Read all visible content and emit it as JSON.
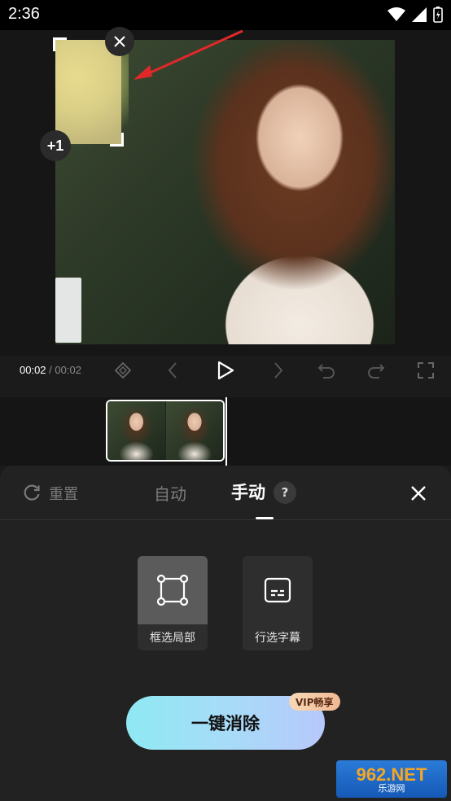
{
  "status": {
    "time": "2:36"
  },
  "preview": {
    "close_box_glyph": "×",
    "plus_one": "+1"
  },
  "player": {
    "current_time": "00:02",
    "separator": " / ",
    "total_time": "00:02",
    "controls": [
      "keyframe-icon",
      "prev-icon",
      "play-icon",
      "next-icon",
      "undo-icon",
      "redo-icon",
      "fullscreen-icon"
    ]
  },
  "panel": {
    "reset_label": "重置",
    "tab_auto": "自动",
    "tab_manual": "手动",
    "help_glyph": "?",
    "options": [
      {
        "label": "框选局部",
        "icon": "box-select-icon",
        "selected": true
      },
      {
        "label": "行选字幕",
        "icon": "subtitle-icon",
        "selected": false
      }
    ],
    "remove_button": "一键消除",
    "vip_badge": "VIP畅享"
  },
  "watermark": {
    "brand": "962.NET",
    "sub": "乐游网"
  },
  "colors": {
    "background": "#1b1b1b",
    "panel": "#222222",
    "accent_gradient_start": "#8fe9f3",
    "accent_gradient_end": "#b7c8fb",
    "annotation_arrow": "#e0282a"
  }
}
